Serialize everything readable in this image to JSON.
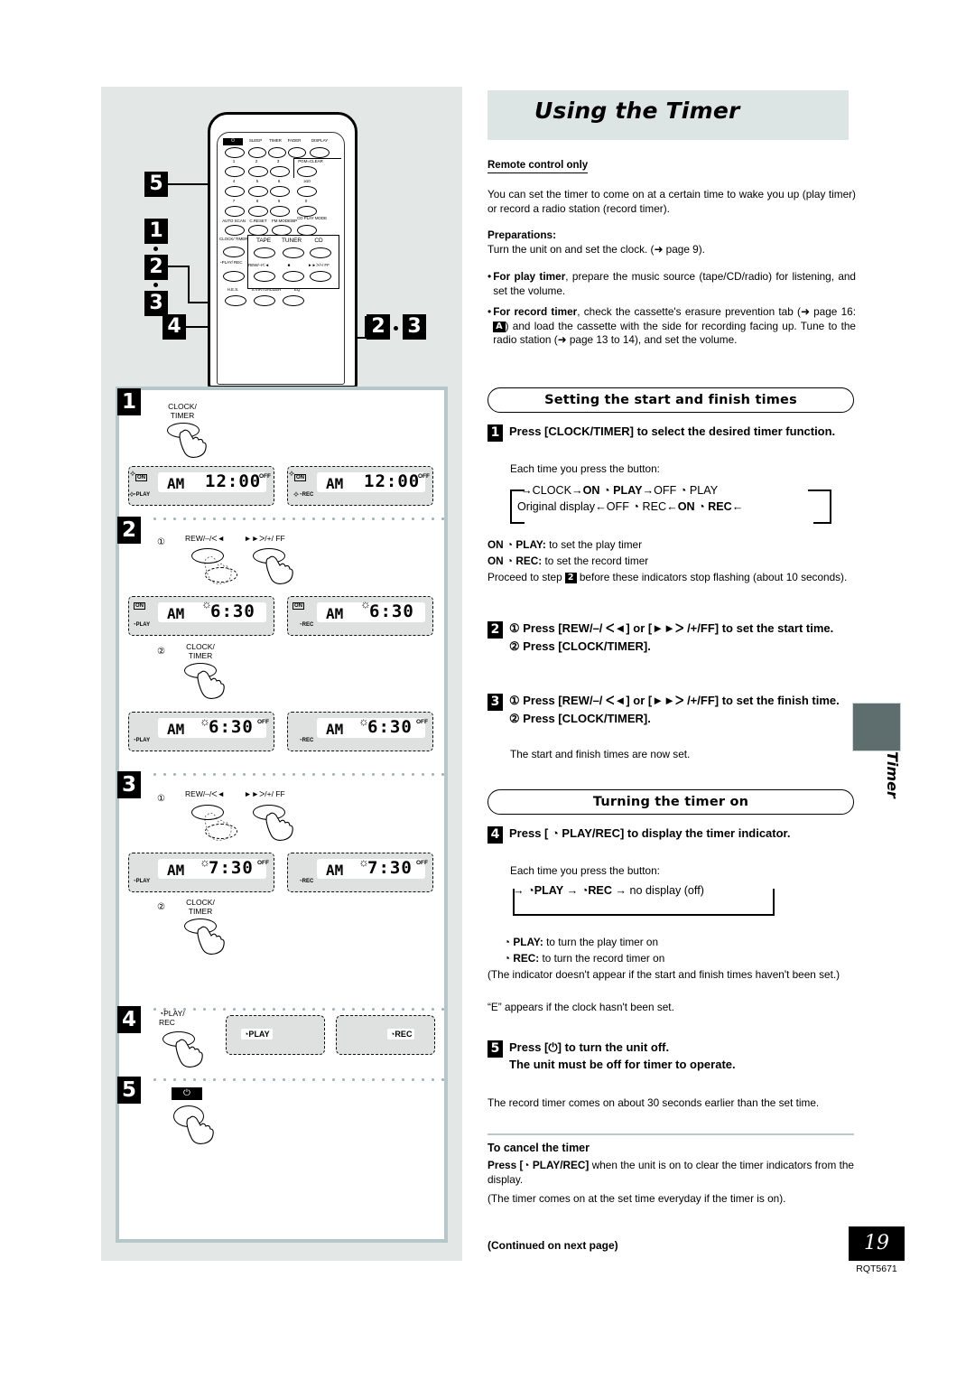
{
  "page": {
    "title": "Using the Timer",
    "side_tab_label": "Timer",
    "page_number": "19",
    "doc_code": "RQT5671",
    "continued": "(Continued on next page)"
  },
  "intro": {
    "remote_only": "Remote control only",
    "paragraph": "You can set the timer to come on at a certain time to wake you up (play timer) or record a radio station (record timer).",
    "preparations_label": "Preparations:",
    "preparations_line": "Turn the unit on and set the clock. (➜ page 9).",
    "bullets": [
      {
        "bold": "For play timer",
        "rest": ", prepare the music source (tape/CD/radio) for listening, and set the volume."
      },
      {
        "bold": "For record timer",
        "rest_1": ", check the cassette's erasure prevention tab (➜ page 16: ",
        "badge": "A",
        "rest_2": ") and load the cassette with the side for recording facing up. Tune to the radio station (➜ page 13 to 14), and set the volume."
      }
    ]
  },
  "section_start_finish": {
    "heading": "Setting the start and finish times",
    "step1": {
      "num": "1",
      "title": "Press [CLOCK/TIMER] to select the desired timer function.",
      "each_time": "Each time you press the button:",
      "cycle_top": [
        "CLOCK",
        "ON ◔ PLAY",
        "OFF ◔ PLAY"
      ],
      "cycle_bottom": [
        "Original display",
        "OFF ◔ REC",
        "ON ◔ REC"
      ],
      "note_play": "ON ◔ PLAY:",
      "note_play_rest": " to set the play timer",
      "note_rec": "ON ◔ REC:",
      "note_rec_rest": " to set the record timer",
      "proceed_1": "Proceed to step ",
      "proceed_badge": "2",
      "proceed_2": " before these indicators stop flashing (about 10 seconds)."
    },
    "step2": {
      "num": "2",
      "line1": "① Press [REW/–/ ᐸ◄] or [►►ᐳ /+/FF] to set the start time.",
      "line2": "② Press [CLOCK/TIMER]."
    },
    "step3": {
      "num": "3",
      "line1": "① Press [REW/–/ ᐸ◄] or [►►ᐳ /+/FF] to set the finish time.",
      "line2": "② Press [CLOCK/TIMER].",
      "note": "The start and finish times are now set."
    }
  },
  "section_turning_on": {
    "heading": "Turning the timer on",
    "step4": {
      "num": "4",
      "title": "Press [ ◔ PLAY/REC] to display the timer indicator.",
      "each_time": "Each time you press the button:",
      "cycle": [
        "◔PLAY",
        "◔REC",
        "no display (off)"
      ],
      "note_play": "◔ PLAY:",
      "note_play_rest": " to turn the play timer on",
      "note_rec": "◔ REC:",
      "note_rec_rest": " to turn the record timer on",
      "note_paren": "(The indicator doesn't appear if the start and finish times haven't been set.)",
      "note_e": "“E” appears if the clock hasn't been set."
    },
    "step5": {
      "num": "5",
      "title": "Press [⏻] to turn the unit off.",
      "subtitle": "The unit must be off for timer to operate.",
      "note": "The record timer comes on about 30 seconds earlier than the set time."
    }
  },
  "section_cancel": {
    "heading": "To cancel the timer",
    "line1_a": "Press [",
    "line1_icon": "◔",
    "line1_b": " PLAY/REC]",
    "line1_c": " when the unit is on to clear the timer indicators from the display.",
    "line2": "(The timer comes on at the set time everyday if the timer is on)."
  },
  "remote": {
    "callouts": [
      "5",
      "1",
      "2",
      "3",
      "4",
      "2·3"
    ],
    "rows": [
      {
        "labels": [
          "⏻",
          "SLEEP",
          "TIMER",
          "FADER",
          "DISPLAY"
        ]
      },
      {
        "labels": [
          "1",
          "2",
          "3",
          "PGM=CLEAR"
        ]
      },
      {
        "labels": [
          "4",
          "5",
          "6",
          "≥10"
        ]
      },
      {
        "labels": [
          "7",
          "8",
          "9",
          "0"
        ]
      },
      {
        "labels": [
          "AUTO SCAN",
          "C.RESET",
          "FM MODE/BP",
          "CD PLAY MODE"
        ]
      },
      {
        "labels": [
          "CLOCK/ TIMER",
          "TAPE",
          "TUNER",
          "CD"
        ]
      },
      {
        "labels": [
          "◔PLAY/ REC",
          "REW/–/ᐸ◄",
          "■",
          "►►ᐳ/+/ FF"
        ]
      },
      {
        "labels": [
          "H.E.S.",
          "S.VIRTUALIZER",
          "EQ"
        ]
      }
    ]
  },
  "steps_panel": {
    "step1": {
      "badge": "1",
      "button_label": "CLOCK/\nTIMER",
      "displays": [
        {
          "ampm": "AM",
          "time": "12:00",
          "off": "OFF",
          "on": "ON",
          "mode": "◔PLAY",
          "flash_on": true,
          "flash_mode": true,
          "flash_time": false
        },
        {
          "ampm": "AM",
          "time": "12:00",
          "off": "OFF",
          "on": "ON",
          "mode": "◔REC",
          "flash_on": true,
          "flash_mode": true,
          "flash_time": false
        }
      ]
    },
    "step2": {
      "badge": "2",
      "sub1": "①",
      "sub2": "②",
      "btn_left_label": "REW/–/ᐸ◄",
      "btn_right_label": "►►ᐳ/+/ FF",
      "button_label2": "CLOCK/\nTIMER",
      "displays_a": [
        {
          "ampm": "AM",
          "time": "6:30",
          "off": "",
          "on": "ON",
          "mode": "◔PLAY",
          "flash_time": true
        },
        {
          "ampm": "AM",
          "time": "6:30",
          "off": "",
          "on": "ON",
          "mode": "◔REC",
          "flash_time": true
        }
      ],
      "displays_b": [
        {
          "ampm": "AM",
          "time": "6:30",
          "off": "OFF",
          "on": "",
          "mode": "◔PLAY",
          "flash_time": true
        },
        {
          "ampm": "AM",
          "time": "6:30",
          "off": "OFF",
          "on": "",
          "mode": "◔REC",
          "flash_time": true
        }
      ]
    },
    "step3": {
      "badge": "3",
      "sub1": "①",
      "sub2": "②",
      "btn_left_label": "REW/–/ᐸ◄",
      "btn_right_label": "►►ᐳ/+/ FF",
      "button_label2": "CLOCK/\nTIMER",
      "displays_a": [
        {
          "ampm": "AM",
          "time": "7:30",
          "off": "OFF",
          "on": "",
          "mode": "◔PLAY",
          "flash_time": true
        },
        {
          "ampm": "AM",
          "time": "7:30",
          "off": "OFF",
          "on": "",
          "mode": "◔REC",
          "flash_time": true
        }
      ]
    },
    "step4": {
      "badge": "4",
      "button_label": "◔PLAY/\nREC",
      "indicators": [
        "◔PLAY",
        "◔REC"
      ]
    },
    "step5": {
      "badge": "5",
      "button_label": "⏻"
    }
  },
  "colors": {
    "panel_bg": "#e3e8e7",
    "title_bg": "#dde4e4",
    "step_border": "#b5c7c9",
    "lcd_bg": "#dfe0e0",
    "tab": "#5e6d6e"
  }
}
